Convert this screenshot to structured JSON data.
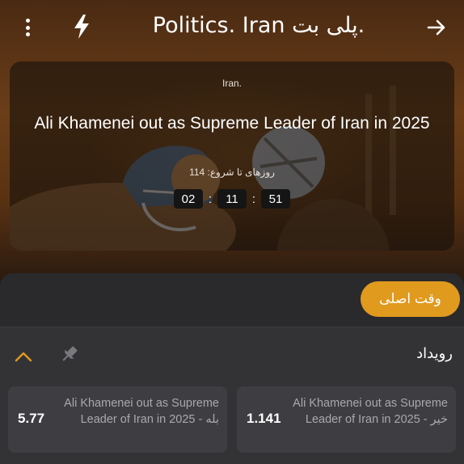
{
  "header": {
    "title": "Politics. Iran پلی بت.",
    "icons": [
      "more-vertical-icon",
      "lightning-icon",
      "arrow-right-icon"
    ]
  },
  "event": {
    "category": "Iran.",
    "title": "Ali Khamenei out as Supreme Leader of Iran in 2025",
    "countdown_label": "روزهای تا شروع: 114",
    "countdown": {
      "hours": "02",
      "minutes": "11",
      "seconds": "51"
    }
  },
  "tabs": {
    "main": "وقت اصلی"
  },
  "market": {
    "title": "رویداد",
    "outcomes": [
      {
        "name": "Ali Khamenei out as Supreme Leader of Iran in 2025 - بله",
        "odds": "5.77"
      },
      {
        "name": "Ali Khamenei out as Supreme Leader of Iran in 2025 - خیر",
        "odds": "1.141"
      }
    ]
  },
  "colors": {
    "accent": "#e09a1e",
    "sheet": "#2a2a2c",
    "panel": "#333336",
    "odds_button": "#3e3e42",
    "muted_text": "#a9a9ad"
  }
}
